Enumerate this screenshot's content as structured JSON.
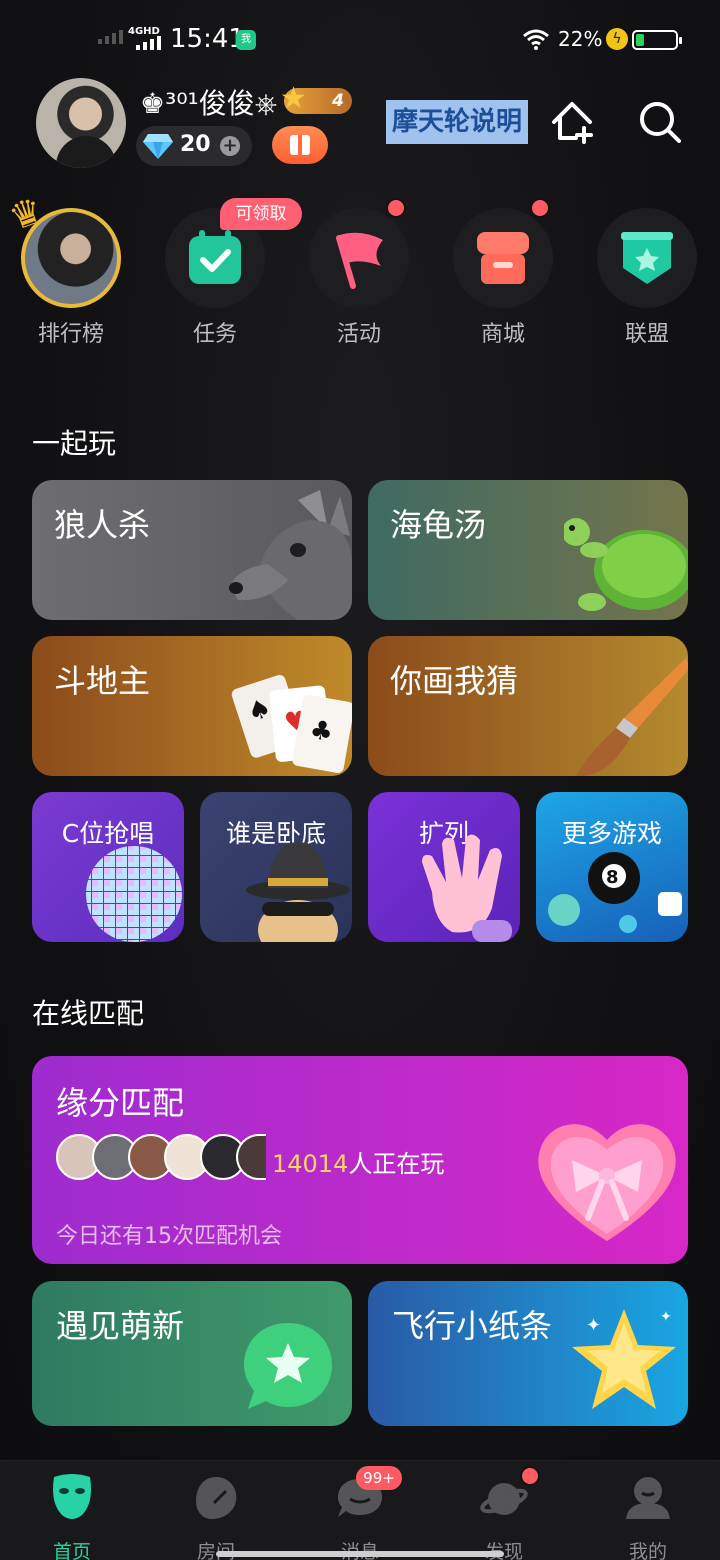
{
  "status_bar": {
    "time": "15:41",
    "network": "4GHD",
    "battery_pct": "22%",
    "battery_level": 0.22
  },
  "user": {
    "rank_prefix": "♚³⁰¹",
    "name": "俊俊",
    "name_suffix": "⎈",
    "level": "4",
    "diamonds": "20"
  },
  "header": {
    "desc_link": "摩天轮说明"
  },
  "quick_nav": [
    {
      "label": "排行榜",
      "icon": "ranking-crown-avatar"
    },
    {
      "label": "任务",
      "icon": "task-calendar-check-icon",
      "badge": "可领取"
    },
    {
      "label": "活动",
      "icon": "flag-icon",
      "dot": true
    },
    {
      "label": "商城",
      "icon": "shop-icon",
      "dot": true
    },
    {
      "label": "联盟",
      "icon": "shield-star-icon"
    }
  ],
  "sections": {
    "play_together": "一起玩",
    "online_match": "在线匹配"
  },
  "games_large": [
    {
      "title": "狼人杀",
      "icon": "wolf-icon"
    },
    {
      "title": "海龟汤",
      "icon": "turtle-icon"
    },
    {
      "title": "斗地主",
      "icon": "playing-cards-icon"
    },
    {
      "title": "你画我猜",
      "icon": "paintbrush-icon"
    }
  ],
  "games_small": [
    {
      "title": "C位抢唱",
      "icon": "disco-ball-icon"
    },
    {
      "title": "谁是卧底",
      "icon": "spy-hat-icon"
    },
    {
      "title": "扩列",
      "icon": "waving-hand-icon"
    },
    {
      "title": "更多游戏",
      "icon": "billiard-8-ball-icon"
    }
  ],
  "match": {
    "title": "缘分匹配",
    "player_count": "14014",
    "playing_text": "人正在玩",
    "remaining": "今日还有15次匹配机会"
  },
  "match_cards": [
    {
      "title": "遇见萌新",
      "icon": "chat-bubble-star-icon"
    },
    {
      "title": "飞行小纸条",
      "icon": "star-icon"
    }
  ],
  "bottom_nav": [
    {
      "label": "首页",
      "active": true
    },
    {
      "label": "房间"
    },
    {
      "label": "消息",
      "badge": "99+"
    },
    {
      "label": "发现",
      "dot": true
    },
    {
      "label": "我的"
    }
  ],
  "colors": {
    "accent": "#27d2a4",
    "badge_red": "#ff5b63"
  }
}
